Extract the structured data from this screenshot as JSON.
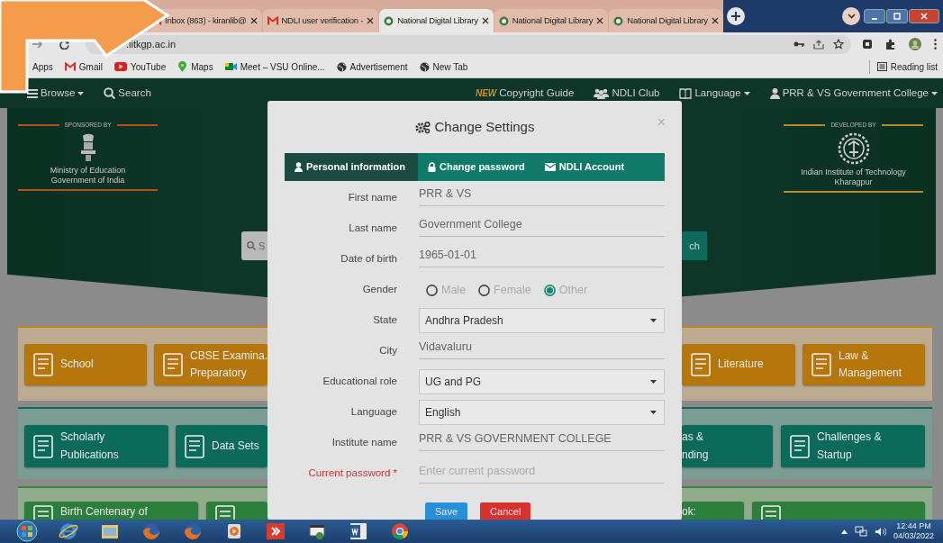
{
  "browser": {
    "tabs": [
      {
        "title": "Inbox (863) - kiranlib@",
        "kind": "mail",
        "selected": false
      },
      {
        "title": "NDLI user verification -",
        "kind": "mail",
        "selected": false
      },
      {
        "title": "National Digital Library",
        "kind": "library",
        "selected": true
      },
      {
        "title": "National Digital Library",
        "kind": "library",
        "selected": false
      },
      {
        "title": "National Digital Library",
        "kind": "library",
        "selected": false
      }
    ],
    "address": ".iitkgp.ac.in",
    "bookmarks": [
      {
        "label": "Apps",
        "kind": "apps"
      },
      {
        "label": "Gmail",
        "kind": "mail"
      },
      {
        "label": "YouTube",
        "kind": "video"
      },
      {
        "label": "Maps",
        "kind": "map"
      },
      {
        "label": "Meet – VSU Online...",
        "kind": "meet"
      },
      {
        "label": "Advertisement",
        "kind": "globe"
      },
      {
        "label": "New Tab",
        "kind": "globe"
      }
    ],
    "reading_list": "Reading list"
  },
  "site_nav": {
    "left": [
      {
        "label": "Browse",
        "kind": "menu",
        "dropdown": true
      },
      {
        "label": "Search",
        "kind": "search",
        "dropdown": false
      }
    ],
    "right": [
      {
        "label": "Copyright Guide",
        "badge": "NEW",
        "kind": "badge",
        "dropdown": false
      },
      {
        "label": "NDLI Club",
        "kind": "club",
        "dropdown": false
      },
      {
        "label": "Language",
        "kind": "language",
        "dropdown": true
      },
      {
        "label": "PRR & VS Government College",
        "kind": "user",
        "dropdown": true
      }
    ]
  },
  "hero": {
    "sponsor": {
      "caption": "SPONSORED BY",
      "lines": [
        "Ministry of Education",
        "Government of India"
      ]
    },
    "developer": {
      "caption": "DEVELOPED BY",
      "lines": [
        "Indian Institute of Technology",
        "Kharagpur"
      ]
    },
    "search_text": "S",
    "search_button": "ch"
  },
  "bands": [
    {
      "kind": "orange",
      "left": [
        {
          "lines": [
            "School"
          ],
          "icon": true
        },
        {
          "lines": [
            "CBSE Examina.",
            "Preparatory"
          ],
          "icon": true
        }
      ],
      "right": [
        {
          "lines": [
            "Literature"
          ],
          "icon": true
        },
        {
          "lines": [
            "Law &",
            "Management"
          ],
          "icon": true
        }
      ]
    },
    {
      "kind": "teal",
      "left": [
        {
          "lines": [
            "Scholarly",
            "Publications"
          ],
          "icon": true
        },
        {
          "lines": [
            "Data Sets"
          ],
          "icon": true
        }
      ],
      "right": [
        {
          "lines": [
            "as &",
            "nding"
          ],
          "icon": false
        },
        {
          "lines": [
            "Challenges &",
            "Startup"
          ],
          "icon": true
        }
      ]
    },
    {
      "kind": "green",
      "left": [
        {
          "lines": [
            "Birth Centenary of"
          ],
          "icon": true
        },
        {
          "icon": true
        }
      ],
      "right": [
        {
          "lines": [
            "ok:"
          ],
          "icon": false
        },
        {
          "icon": true
        }
      ]
    }
  ],
  "modal": {
    "title": "Change Settings",
    "close": "×",
    "tabs": [
      {
        "label": "Personal information",
        "kind": "user",
        "selected": true
      },
      {
        "label": "Change password",
        "kind": "lock",
        "selected": false
      },
      {
        "label": "NDLI Account",
        "kind": "mail",
        "selected": false
      }
    ],
    "fields": [
      {
        "label": "First name",
        "kind": "text",
        "value": "PRR & VS"
      },
      {
        "label": "Last name",
        "kind": "text",
        "value": "Government College"
      },
      {
        "label": "Date of birth",
        "kind": "text",
        "value": "1965-01-01"
      },
      {
        "label": "Gender",
        "kind": "radio",
        "options": [
          {
            "label": "Male",
            "selected": false
          },
          {
            "label": "Female",
            "selected": false
          },
          {
            "label": "Other",
            "selected": true
          }
        ]
      },
      {
        "label": "State",
        "kind": "select",
        "value": "Andhra Pradesh"
      },
      {
        "label": "City",
        "kind": "text",
        "value": "Vidavaluru"
      },
      {
        "label": "Educational role",
        "kind": "select",
        "value": "UG and PG"
      },
      {
        "label": "Language",
        "kind": "select",
        "value": "English"
      },
      {
        "label": "Institute name",
        "kind": "text",
        "value": "PRR & VS GOVERNMENT COLLEGE"
      },
      {
        "label": "Current password *",
        "kind": "password",
        "placeholder": "Enter current password",
        "required": true
      }
    ],
    "buttons": [
      {
        "label": "Save",
        "kind": "primary"
      },
      {
        "label": "Cancel",
        "kind": "danger"
      }
    ]
  },
  "taskbar": {
    "time": "12:44 PM",
    "date": "04/03/2022"
  }
}
